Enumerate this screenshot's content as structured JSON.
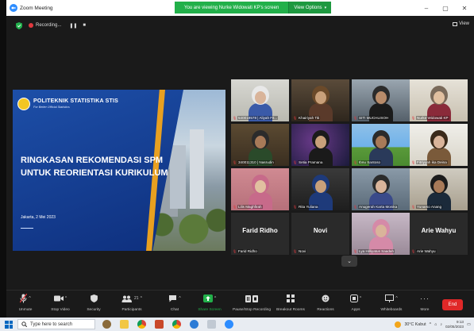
{
  "window": {
    "title": "Zoom Meeting",
    "viewing_banner": "You are viewing Nurke Widowati KP's screen",
    "view_options": "View Options",
    "minimize": "–",
    "restore": "▢",
    "close": "✕"
  },
  "status_bar": {
    "recording": "Recording...",
    "pause": "❚❚",
    "stop": "■",
    "view": "View"
  },
  "slide": {
    "institution": "POLITEKNIK STATISTIKA STIS",
    "tagline": "For Better Official Statistics",
    "title_line1": "RINGKASAN REKOMENDASI SPM",
    "title_line2": "UNTUK REORIENTASI KURIKULUM",
    "date": "Jakarta, 2 Mei 2023"
  },
  "participants": [
    {
      "name": "540019578 | Aliyah Fit..."
    },
    {
      "name": "Khairiyah Titi"
    },
    {
      "name": "SITI MUCHLISOH"
    },
    {
      "name": "Nurke Widowati KP"
    },
    {
      "name": "340011310 | Nasrudin"
    },
    {
      "name": "Setia Pramana"
    },
    {
      "name": "Ibnu Santoso"
    },
    {
      "name": "Fitriyyah ika Deina"
    },
    {
      "name": "Lilis Maghfirah"
    },
    {
      "name": "Rita Yuliana"
    },
    {
      "name": "Anugerah Karta Monika"
    },
    {
      "name": "Yunarso Anang"
    },
    {
      "name": "Farid Ridho",
      "display": "Farid Ridho"
    },
    {
      "name": "Novi",
      "display": "Novi"
    },
    {
      "name": "Lya Hilliyatus Saadah"
    },
    {
      "name": "Arie Wahyu",
      "display": "Arie Wahyu"
    }
  ],
  "toolbar": {
    "unmute": "Unmute",
    "stop_video": "Stop Video",
    "security": "Security",
    "participants": "Participants",
    "participants_count": "21",
    "chat": "Chat",
    "share_screen": "Share Screen",
    "pause_recording": "Pause/Stop Recording",
    "breakout_rooms": "Breakout Rooms",
    "reactions": "Reactions",
    "apps": "Apps",
    "whiteboards": "Whiteboards",
    "more": "More",
    "end": "End"
  },
  "taskbar": {
    "search_placeholder": "Type here to search",
    "weather": "30°C Kabut",
    "time": "9:13",
    "date": "02/05/2023"
  },
  "colors": {
    "zoom_blue": "#2D8CFF",
    "banner_green": "#22b04a",
    "active_speaker": "#dff41e",
    "end_red": "#e02828",
    "share_green": "#22b04a"
  }
}
